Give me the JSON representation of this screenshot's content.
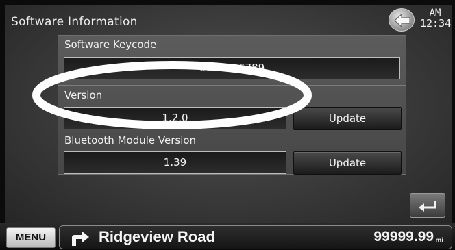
{
  "header": {
    "title": "Software Information",
    "clock_ampm": "AM",
    "clock_time": "12:34"
  },
  "keycode": {
    "label": "Software Keycode",
    "value": "0123456789"
  },
  "version": {
    "label": "Version",
    "value": "1.2.0",
    "update_label": "Update"
  },
  "bluetooth": {
    "label": "Bluetooth Module Version",
    "value": "1.39",
    "update_label": "Update"
  },
  "bottom_bar": {
    "menu_label": "MENU",
    "street": "Ridgeview Road",
    "distance": "99999.99",
    "unit": "mi"
  },
  "icons": {
    "back": "back-arrow-icon",
    "return": "return-arrow-icon",
    "turn": "turn-right-arrow-icon"
  }
}
